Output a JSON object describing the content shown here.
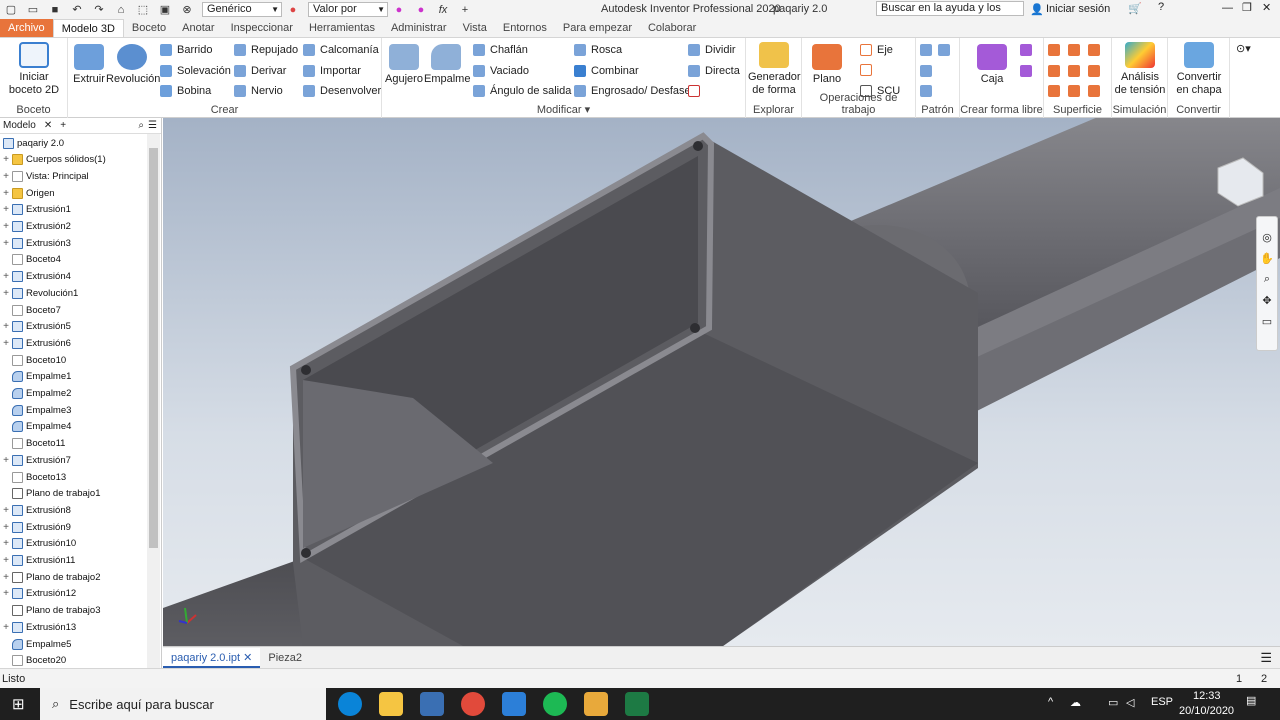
{
  "app": {
    "title": "Autodesk Inventor Professional 2020",
    "document": "paqariy 2.0",
    "search_placeholder": "Buscar en la ayuda y los comandos",
    "signin": "Iniciar sesión",
    "material": "Genérico",
    "appearance": "Valor por defecto"
  },
  "tabs": [
    "Archivo",
    "Modelo 3D",
    "Boceto",
    "Anotar",
    "Inspeccionar",
    "Herramientas",
    "Administrar",
    "Vista",
    "Entornos",
    "Para empezar",
    "Colaborar"
  ],
  "ribbon": {
    "boceto": {
      "label": "Boceto",
      "start": "Iniciar boceto 2D"
    },
    "crear": {
      "label": "Crear",
      "extruir": "Extruir",
      "revolucion": "Revolución",
      "barrido": "Barrido",
      "solevacion": "Solevación",
      "bobina": "Bobina",
      "repujado": "Repujado",
      "derivar": "Derivar",
      "nervio": "Nervio",
      "calcomania": "Calcomanía",
      "importar": "Importar",
      "desenvolver": "Desenvolver"
    },
    "modificar": {
      "label": "Modificar",
      "agujero": "Agujero",
      "empalme": "Empalme",
      "chaflan": "Chaflán",
      "vaciado": "Vaciado",
      "angulo": "Ángulo de salida",
      "rosca": "Rosca",
      "combinar": "Combinar",
      "engrosado": "Engrosado/ Desfase",
      "dividir": "Dividir",
      "directa": "Directa"
    },
    "explorar": {
      "label": "Explorar",
      "generador": "Generador de forma"
    },
    "operaciones": {
      "label": "Operaciones de trabajo",
      "plano": "Plano",
      "eje": "Eje",
      "scu": "SCU"
    },
    "patron": {
      "label": "Patrón"
    },
    "forma_libre": {
      "label": "Crear forma libre",
      "caja": "Caja"
    },
    "superficie": {
      "label": "Superficie"
    },
    "simulacion": {
      "label": "Simulación",
      "analisis": "Análisis de tensión"
    },
    "convertir": {
      "label": "Convertir",
      "chapa": "Convertir en chapa"
    }
  },
  "browser": {
    "tab": "Modelo",
    "nodes": [
      {
        "label": "paqariy 2.0",
        "icon": "part",
        "expand": false,
        "root": true
      },
      {
        "label": "Cuerpos sólidos(1)",
        "icon": "folder",
        "expand": true
      },
      {
        "label": "Vista: Principal",
        "icon": "sk",
        "expand": true
      },
      {
        "label": "Origen",
        "icon": "folder",
        "expand": true
      },
      {
        "label": "Extrusión1",
        "icon": "part",
        "expand": true
      },
      {
        "label": "Extrusión2",
        "icon": "part",
        "expand": true
      },
      {
        "label": "Extrusión3",
        "icon": "part",
        "expand": true
      },
      {
        "label": "Boceto4",
        "icon": "sk",
        "expand": false
      },
      {
        "label": "Extrusión4",
        "icon": "part",
        "expand": true
      },
      {
        "label": "Revolución1",
        "icon": "part",
        "expand": true
      },
      {
        "label": "Boceto7",
        "icon": "sk",
        "expand": false
      },
      {
        "label": "Extrusión5",
        "icon": "part",
        "expand": true
      },
      {
        "label": "Extrusión6",
        "icon": "part",
        "expand": true
      },
      {
        "label": "Boceto10",
        "icon": "sk",
        "expand": false
      },
      {
        "label": "Empalme1",
        "icon": "fil",
        "expand": false
      },
      {
        "label": "Empalme2",
        "icon": "fil",
        "expand": false
      },
      {
        "label": "Empalme3",
        "icon": "fil",
        "expand": false
      },
      {
        "label": "Empalme4",
        "icon": "fil",
        "expand": false
      },
      {
        "label": "Boceto11",
        "icon": "sk",
        "expand": false
      },
      {
        "label": "Extrusión7",
        "icon": "part",
        "expand": true
      },
      {
        "label": "Boceto13",
        "icon": "sk",
        "expand": false
      },
      {
        "label": "Plano de trabajo1",
        "icon": "pln",
        "expand": false
      },
      {
        "label": "Extrusión8",
        "icon": "part",
        "expand": true
      },
      {
        "label": "Extrusión9",
        "icon": "part",
        "expand": true
      },
      {
        "label": "Extrusión10",
        "icon": "part",
        "expand": true
      },
      {
        "label": "Extrusión11",
        "icon": "part",
        "expand": true
      },
      {
        "label": "Plano de trabajo2",
        "icon": "pln",
        "expand": true
      },
      {
        "label": "Extrusión12",
        "icon": "part",
        "expand": true
      },
      {
        "label": "Plano de trabajo3",
        "icon": "pln",
        "expand": false
      },
      {
        "label": "Extrusión13",
        "icon": "part",
        "expand": true
      },
      {
        "label": "Empalme5",
        "icon": "fil",
        "expand": false
      },
      {
        "label": "Boceto20",
        "icon": "sk",
        "expand": false
      }
    ]
  },
  "doc_tabs": [
    "paqariy 2.0.ipt",
    "Pieza2"
  ],
  "status": {
    "text": "Listo",
    "page1": "1",
    "page2": "2"
  },
  "taskbar": {
    "search": "Escribe aquí para buscar",
    "lang": "ESP",
    "time": "12:33",
    "date": "20/10/2020"
  },
  "colors": {
    "accent": "#e8743b",
    "model": "#5b5b60",
    "model_light": "#7a7a80"
  }
}
